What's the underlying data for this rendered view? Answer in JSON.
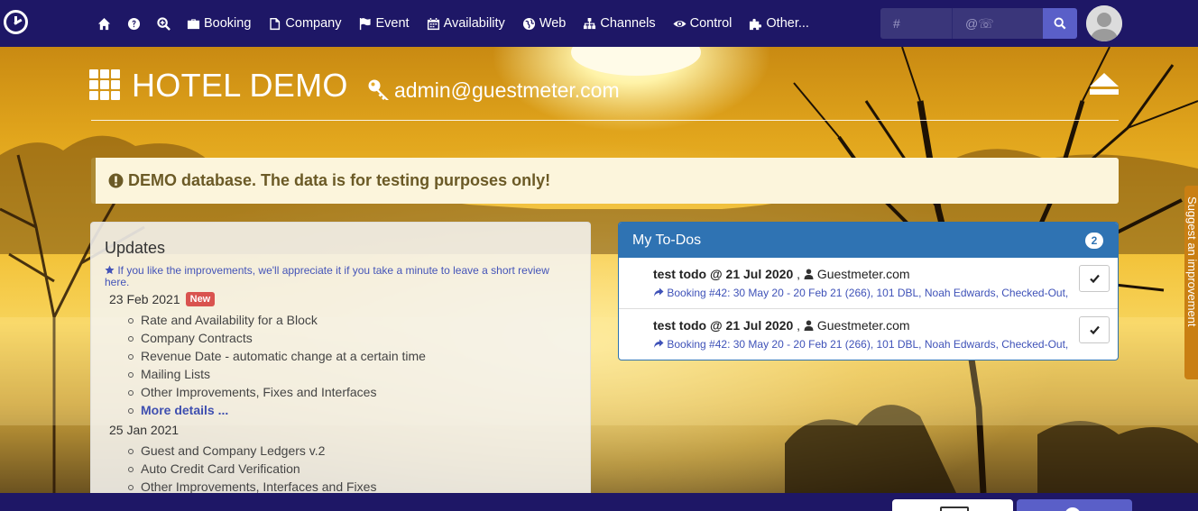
{
  "navbar": {
    "items": [
      {
        "icon": "home-icon",
        "label": ""
      },
      {
        "icon": "question-icon",
        "label": ""
      },
      {
        "icon": "zoom-icon",
        "label": ""
      },
      {
        "icon": "briefcase-icon",
        "label": "Booking"
      },
      {
        "icon": "file-icon",
        "label": "Company"
      },
      {
        "icon": "flag-icon",
        "label": "Event"
      },
      {
        "icon": "calendar-icon",
        "label": "Availability"
      },
      {
        "icon": "globe-icon",
        "label": "Web"
      },
      {
        "icon": "sitemap-icon",
        "label": "Channels"
      },
      {
        "icon": "eye-icon",
        "label": "Control"
      },
      {
        "icon": "puzzle-icon",
        "label": "Other..."
      }
    ],
    "search_number_placeholder": "#",
    "search_email_placeholder": "@☏"
  },
  "header": {
    "hotel_name": "HOTEL DEMO",
    "user_email": "admin@guestmeter.com"
  },
  "banner": {
    "text": "DEMO database. The data is for testing purposes only!"
  },
  "updates": {
    "title": "Updates",
    "review_text": "If you like the improvements, we'll appreciate it if you take a minute to leave a short review here.",
    "groups": [
      {
        "date": "23 Feb 2021",
        "badge": "New",
        "items": [
          "Rate and Availability for a Block",
          "Company Contracts",
          "Revenue Date - automatic change at a certain time",
          "Mailing Lists",
          "Other Improvements, Fixes and Interfaces"
        ],
        "more_label": "More details ..."
      },
      {
        "date": "25 Jan 2021",
        "items": [
          "Guest and Company Ledgers v.2",
          "Auto Credit Card Verification",
          "Other Improvements, Interfaces and Fixes"
        ]
      }
    ]
  },
  "todos": {
    "title": "My To-Dos",
    "count": "2",
    "items": [
      {
        "title": "test todo @ 21 Jul 2020",
        "separator": ",",
        "owner": "Guestmeter.com",
        "link": "Booking #42: 30 May 20 - 20 Feb 21 (266), 101 DBL, Noah Edwards, Checked-Out,"
      },
      {
        "title": "test todo @ 21 Jul 2020",
        "separator": ",",
        "owner": "Guestmeter.com",
        "link": "Booking #42: 30 May 20 - 20 Feb 21 (266), 101 DBL, Noah Edwards, Checked-Out,"
      }
    ]
  },
  "side_tab": {
    "label": "Suggest an improvement"
  },
  "colors": {
    "navbar": "#1e1766",
    "todo_header": "#2f73b3",
    "banner_bg": "#fcf5dc",
    "badge_new": "#d9534f",
    "side_tab": "#c97f13"
  }
}
